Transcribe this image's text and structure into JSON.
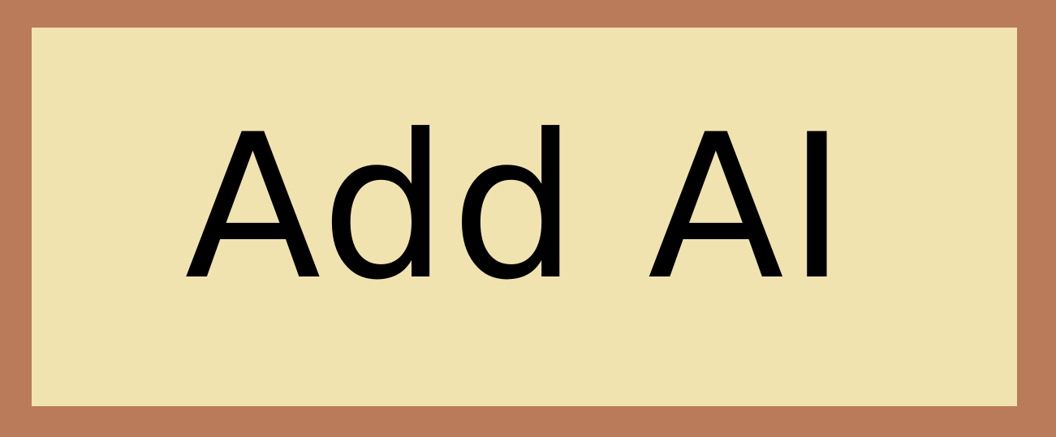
{
  "button": {
    "label": "Add AI"
  },
  "colors": {
    "border": "#b97b59",
    "background": "#f0e3b0",
    "text": "#000000"
  }
}
